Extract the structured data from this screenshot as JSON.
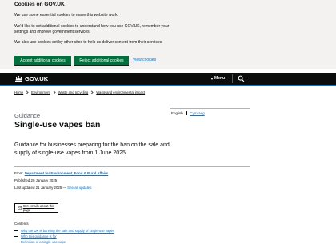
{
  "cookie_banner": {
    "title": "Cookies on GOV.UK",
    "paragraphs": [
      "We use some essential cookies to make this website work.",
      "We'd like to set additional cookies to understand how you use GOV.UK, remember your settings and improve government services.",
      "We also use cookies set by other sites to help us deliver content from their services."
    ],
    "accept_label": "Accept additional cookies",
    "reject_label": "Reject additional cookies",
    "view_label": "View cookies"
  },
  "header": {
    "brand": "GOV.UK",
    "menu_label": "Menu",
    "menu_icon": "chevron-down-icon",
    "search_icon": "search-icon"
  },
  "breadcrumbs": [
    "Home",
    "Environment",
    "Waste and recycling",
    "Waste and environmental impact"
  ],
  "language": {
    "current": "English",
    "alternate": "Cymraeg"
  },
  "page": {
    "caption": "Guidance",
    "title": "Single-use vapes ban",
    "lede": "Guidance for businesses preparing for the ban on the sale and supply of single-use vapes from 1 June 2025."
  },
  "metadata": {
    "from_label": "From:",
    "organisation": "Department for Environment, Food & Rural Affairs",
    "published": "Published 20 January 2025",
    "last_updated": "Last updated 21 January 2025 —",
    "see_updates": "See all updates"
  },
  "emails": {
    "label": "Get emails about this page",
    "icon": "envelope-icon"
  },
  "contents": {
    "heading": "Contents",
    "items": [
      "Why the UK is banning the sale and supply of single-use vapes",
      "Who this guidance is for",
      "Definition of a single-use vape"
    ]
  },
  "colors": {
    "brand_blue": "#1d70b8",
    "button_green": "#00703c",
    "header_black": "#0b0c0c",
    "banner_grey": "#f3f2f1"
  }
}
